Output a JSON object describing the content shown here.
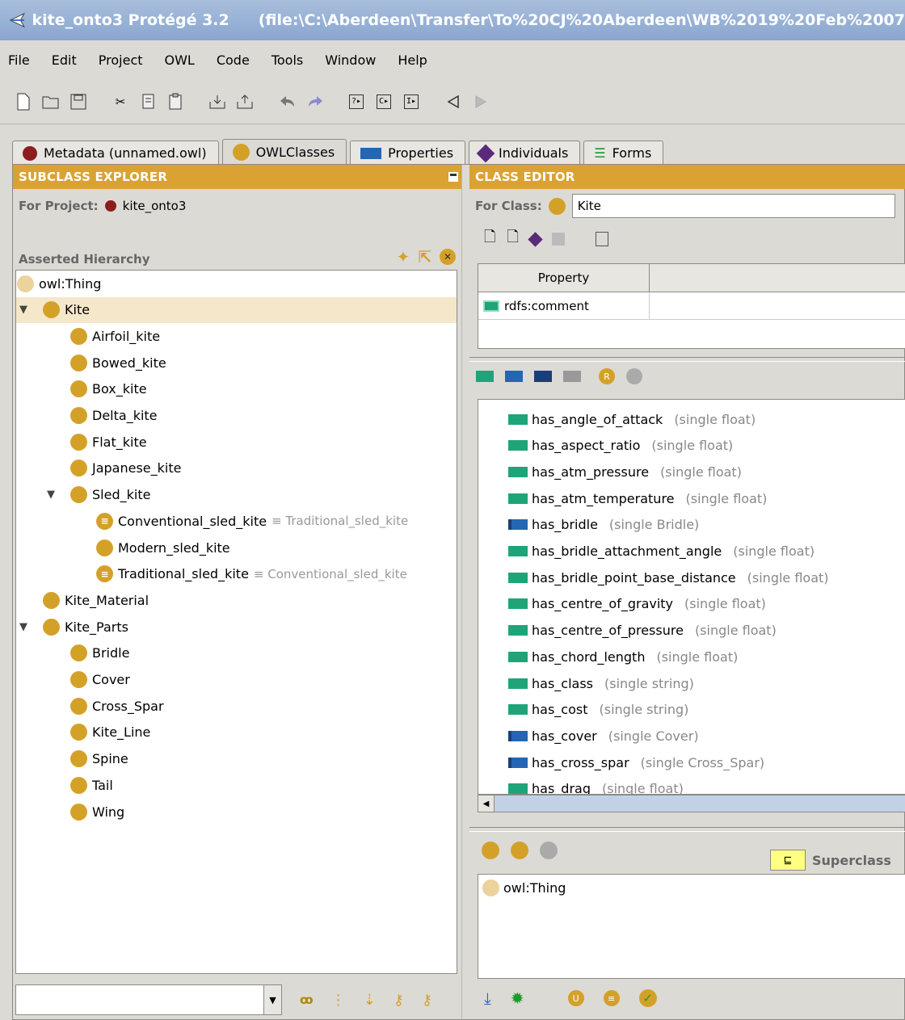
{
  "window": {
    "title_app": "kite_onto3  Protégé 3.2",
    "title_path": "(file:\\C:\\Aberdeen\\Transfer\\To%20CJ%20Aberdeen\\WB%2019%20Feb%2007"
  },
  "menu": [
    "File",
    "Edit",
    "Project",
    "OWL",
    "Code",
    "Tools",
    "Window",
    "Help"
  ],
  "tabs": [
    {
      "label": "Metadata (unnamed.owl)",
      "icon": "metadata-icon",
      "color": "#8b1d1d"
    },
    {
      "label": "OWLClasses",
      "icon": "class-icon",
      "color": "#d4a128"
    },
    {
      "label": "Properties",
      "icon": "property-icon",
      "color": "#2366b3"
    },
    {
      "label": "Individuals",
      "icon": "individual-icon",
      "color": "#5a2a7a"
    },
    {
      "label": "Forms",
      "icon": "forms-icon",
      "color": "#1a9a2a"
    }
  ],
  "subclass": {
    "header": "SUBCLASS EXPLORER",
    "for_project_label": "For Project:",
    "project": "kite_onto3",
    "hierarchy_label": "Asserted Hierarchy",
    "tree": [
      {
        "label": "owl:Thing",
        "depth": 0,
        "pale": true
      },
      {
        "label": "Kite",
        "depth": 1,
        "expanded": true,
        "selected": true
      },
      {
        "label": "Airfoil_kite",
        "depth": 2
      },
      {
        "label": "Bowed_kite",
        "depth": 2
      },
      {
        "label": "Box_kite",
        "depth": 2
      },
      {
        "label": "Delta_kite",
        "depth": 2
      },
      {
        "label": "Flat_kite",
        "depth": 2
      },
      {
        "label": "Japanese_kite",
        "depth": 2
      },
      {
        "label": "Sled_kite",
        "depth": 2,
        "expanded": true
      },
      {
        "label": "Conventional_sled_kite",
        "depth": 3,
        "equiv": "≡ Traditional_sled_kite"
      },
      {
        "label": "Modern_sled_kite",
        "depth": 3
      },
      {
        "label": "Traditional_sled_kite",
        "depth": 3,
        "equiv": "≡ Conventional_sled_kite"
      },
      {
        "label": "Kite_Material",
        "depth": 1
      },
      {
        "label": "Kite_Parts",
        "depth": 1,
        "expanded": true
      },
      {
        "label": "Bridle",
        "depth": 2
      },
      {
        "label": "Cover",
        "depth": 2
      },
      {
        "label": "Cross_Spar",
        "depth": 2
      },
      {
        "label": "Kite_Line",
        "depth": 2
      },
      {
        "label": "Spine",
        "depth": 2
      },
      {
        "label": "Tail",
        "depth": 2
      },
      {
        "label": "Wing",
        "depth": 2
      }
    ]
  },
  "editor": {
    "header": "CLASS EDITOR",
    "for_class_label": "For Class:",
    "class_name": "Kite",
    "table_header": "Property",
    "annotation": "rdfs:comment",
    "properties": [
      {
        "name": "has_angle_of_attack",
        "meta": "(single float)",
        "kind": "data"
      },
      {
        "name": "has_aspect_ratio",
        "meta": "(single float)",
        "kind": "data"
      },
      {
        "name": "has_atm_pressure",
        "meta": "(single float)",
        "kind": "data"
      },
      {
        "name": "has_atm_temperature",
        "meta": "(single float)",
        "kind": "data"
      },
      {
        "name": "has_bridle",
        "meta": "(single Bridle)",
        "kind": "object"
      },
      {
        "name": "has_bridle_attachment_angle",
        "meta": "(single float)",
        "kind": "data"
      },
      {
        "name": "has_bridle_point_base_distance",
        "meta": "(single float)",
        "kind": "data"
      },
      {
        "name": "has_centre_of_gravity",
        "meta": "(single float)",
        "kind": "data"
      },
      {
        "name": "has_centre_of_pressure",
        "meta": "(single float)",
        "kind": "data"
      },
      {
        "name": "has_chord_length",
        "meta": "(single float)",
        "kind": "data"
      },
      {
        "name": "has_class",
        "meta": "(single string)",
        "kind": "data"
      },
      {
        "name": "has_cost",
        "meta": "(single string)",
        "kind": "data"
      },
      {
        "name": "has_cover",
        "meta": "(single Cover)",
        "kind": "object"
      },
      {
        "name": "has_cross_spar",
        "meta": "(single Cross_Spar)",
        "kind": "object"
      },
      {
        "name": "has_drag",
        "meta": "(single float)",
        "kind": "data"
      }
    ],
    "superclass_button_glyph": "⊑",
    "superclass_label": "Superclass",
    "superclasses": [
      "owl:Thing"
    ]
  }
}
